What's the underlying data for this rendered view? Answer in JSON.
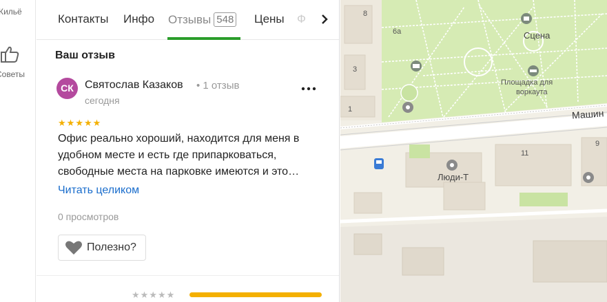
{
  "rail": {
    "items": [
      {
        "label": "Жильё",
        "icon": "home-icon"
      },
      {
        "label": "Советы",
        "icon": "thumbs-up-icon"
      }
    ]
  },
  "tabs": {
    "items": [
      {
        "label": "Контакты"
      },
      {
        "label": "Инфо"
      },
      {
        "label": "Отзывы",
        "count": "548",
        "active": true
      },
      {
        "label": "Цены"
      }
    ],
    "overflow_label": "Ф",
    "next_icon": "chevron-right-icon"
  },
  "review_section": {
    "title": "Ваш отзыв"
  },
  "review": {
    "avatar_initials": "СК",
    "avatar_color": "#b44a9e",
    "author": "Святослав Казаков",
    "author_reviews": "• 1 отзыв",
    "date": "сегодня",
    "more_icon": "more-dots-icon",
    "rating": 5,
    "text": "Офис реально хороший, находится для меня в удобном месте и есть где припарковаться, свободные места на парковке имеются и это…",
    "read_more": "Читать целиком",
    "views": "0 просмотров",
    "useful_label": "Полезно?",
    "useful_icon": "heart-icon"
  },
  "summary": {
    "rating_stars_empty": 5,
    "bar_fraction": 1.0
  },
  "map": {
    "labels": {
      "scene": "Сцена",
      "workout_l1": "Площадка для",
      "workout_l2": "воркаута",
      "street": "Машин",
      "place": "Люди-Т",
      "n8": "8",
      "n3": "3",
      "n1": "1",
      "n11": "11",
      "n9": "9",
      "n6a": "6а"
    },
    "colors": {
      "park": "#d6ebb4",
      "ground": "#f2efe6",
      "building": "#e4ddd0",
      "road": "#ffffff",
      "rail": "#9a9a9a",
      "green_accent": "#c9e3a2"
    }
  },
  "colors": {
    "accent_green": "#2a9d2a",
    "link_blue": "#1a6dcc",
    "star": "#f4b000"
  }
}
